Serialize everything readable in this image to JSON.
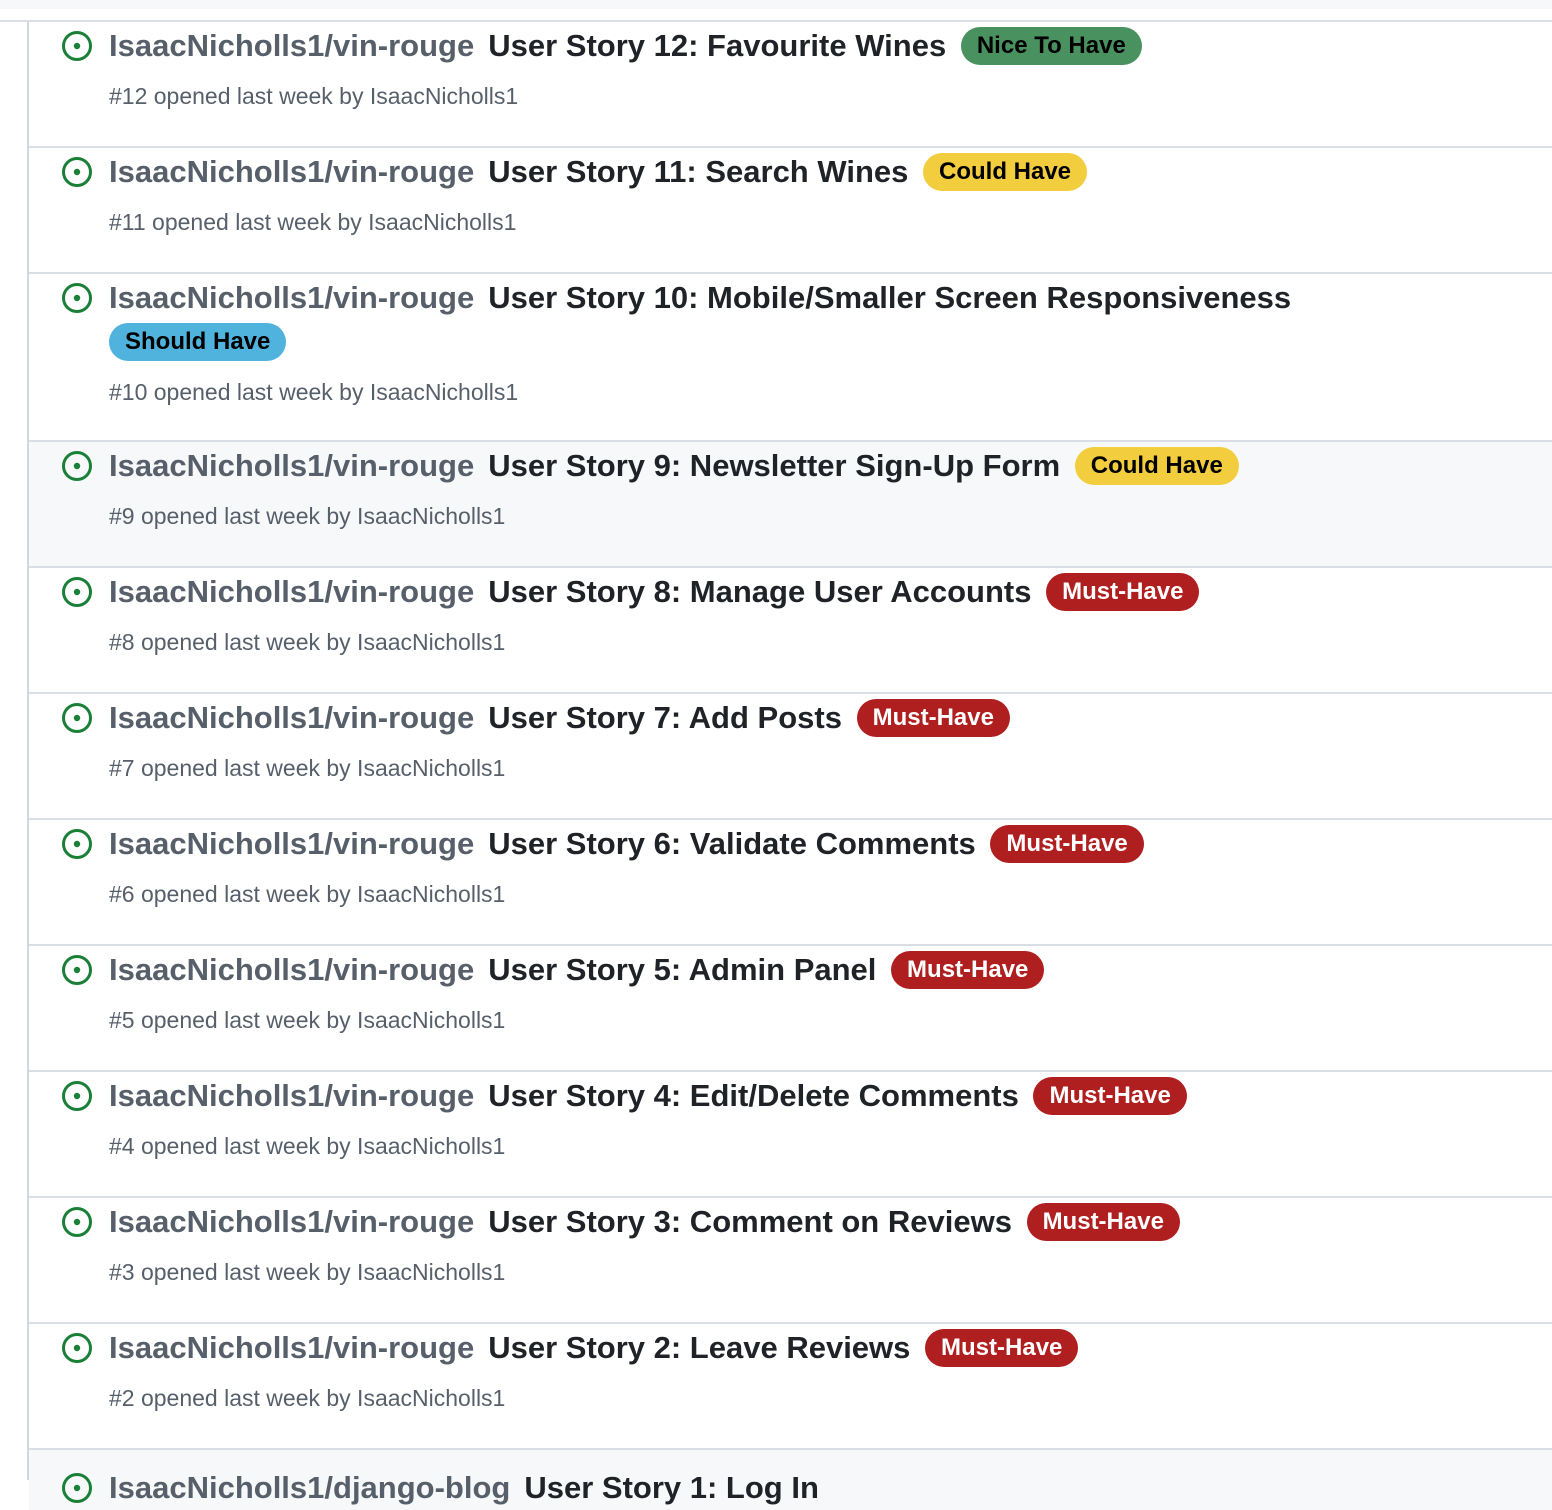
{
  "issues": [
    {
      "repo": "IsaacNicholls1/vin-rouge",
      "title": "User Story 12: Favourite Wines",
      "label": "Nice To Have",
      "label_bg": "#4a9160",
      "label_fg": "#000000",
      "meta": "#12 opened last week by IsaacNicholls1"
    },
    {
      "repo": "IsaacNicholls1/vin-rouge",
      "title": "User Story 11: Search Wines",
      "label": "Could Have",
      "label_bg": "#f2cd3e",
      "label_fg": "#000000",
      "meta": "#11 opened last week by IsaacNicholls1"
    },
    {
      "repo": "IsaacNicholls1/vin-rouge",
      "title": "User Story 10: Mobile/Smaller Screen Responsiveness",
      "label": "Should Have",
      "label_bg": "#4fb3dd",
      "label_fg": "#000000",
      "meta": "#10 opened last week by IsaacNicholls1"
    },
    {
      "repo": "IsaacNicholls1/vin-rouge",
      "title": "User Story 9: Newsletter Sign-Up Form",
      "label": "Could Have",
      "label_bg": "#f2cd3e",
      "label_fg": "#000000",
      "meta": "#9 opened last week by IsaacNicholls1"
    },
    {
      "repo": "IsaacNicholls1/vin-rouge",
      "title": "User Story 8: Manage User Accounts",
      "label": "Must-Have",
      "label_bg": "#b01f1f",
      "label_fg": "#ffffff",
      "meta": "#8 opened last week by IsaacNicholls1"
    },
    {
      "repo": "IsaacNicholls1/vin-rouge",
      "title": "User Story 7: Add Posts",
      "label": "Must-Have",
      "label_bg": "#b01f1f",
      "label_fg": "#ffffff",
      "meta": "#7 opened last week by IsaacNicholls1"
    },
    {
      "repo": "IsaacNicholls1/vin-rouge",
      "title": "User Story 6: Validate Comments",
      "label": "Must-Have",
      "label_bg": "#b01f1f",
      "label_fg": "#ffffff",
      "meta": "#6 opened last week by IsaacNicholls1"
    },
    {
      "repo": "IsaacNicholls1/vin-rouge",
      "title": "User Story 5: Admin Panel",
      "label": "Must-Have",
      "label_bg": "#b01f1f",
      "label_fg": "#ffffff",
      "meta": "#5 opened last week by IsaacNicholls1"
    },
    {
      "repo": "IsaacNicholls1/vin-rouge",
      "title": "User Story 4: Edit/Delete Comments",
      "label": "Must-Have",
      "label_bg": "#b01f1f",
      "label_fg": "#ffffff",
      "meta": "#4 opened last week by IsaacNicholls1"
    },
    {
      "repo": "IsaacNicholls1/vin-rouge",
      "title": "User Story 3: Comment on Reviews",
      "label": "Must-Have",
      "label_bg": "#b01f1f",
      "label_fg": "#ffffff",
      "meta": "#3 opened last week by IsaacNicholls1"
    },
    {
      "repo": "IsaacNicholls1/vin-rouge",
      "title": "User Story 2: Leave Reviews",
      "label": "Must-Have",
      "label_bg": "#b01f1f",
      "label_fg": "#ffffff",
      "meta": "#2 opened last week by IsaacNicholls1"
    },
    {
      "repo": "IsaacNicholls1/django-blog",
      "title": "User Story 1: Log In",
      "label": "",
      "label_bg": "",
      "label_fg": "",
      "meta": ""
    }
  ],
  "colors": {
    "open_icon": "#1a7f37"
  },
  "icon": "issue-opened-icon"
}
